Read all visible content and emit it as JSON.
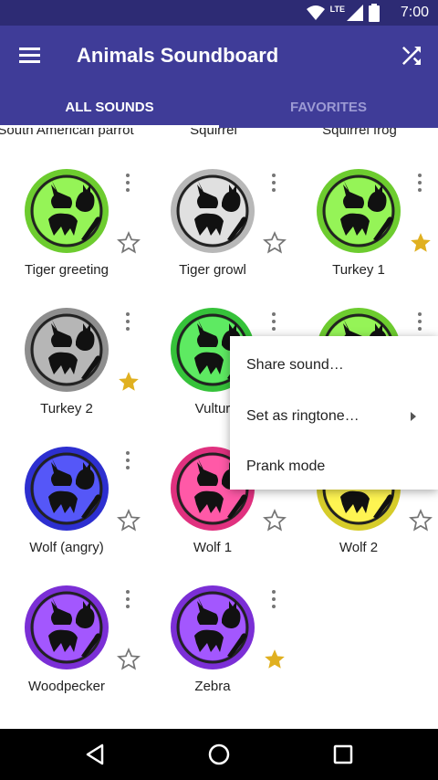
{
  "status_bar": {
    "time": "7:00",
    "network_label": "LTE"
  },
  "app_bar": {
    "title": "Animals Soundboard"
  },
  "tabs": [
    {
      "label": "ALL SOUNDS",
      "active": true
    },
    {
      "label": "FAVORITES",
      "active": false
    }
  ],
  "partial_row_labels": [
    "South American parrot",
    "Squirrel",
    "Squirrel frog"
  ],
  "sounds": [
    {
      "label": "Tiger greeting",
      "color": "#6dcc2f",
      "favorite": false
    },
    {
      "label": "Tiger growl",
      "color": "#b8b8b8",
      "favorite": false
    },
    {
      "label": "Turkey 1",
      "color": "#6dcc2f",
      "favorite": true
    },
    {
      "label": "Turkey 2",
      "color": "#8e8e8e",
      "favorite": true
    },
    {
      "label": "Vultur",
      "color": "#36c23a",
      "favorite": false
    },
    {
      "label": "",
      "color": "#6dcc2f",
      "favorite": false
    },
    {
      "label": "Wolf (angry)",
      "color": "#2d2fd0",
      "favorite": false
    },
    {
      "label": "Wolf 1",
      "color": "#e0317f",
      "favorite": false
    },
    {
      "label": "Wolf 2",
      "color": "#d6cc2a",
      "favorite": false
    },
    {
      "label": "Woodpecker",
      "color": "#7b2fd6",
      "favorite": false
    },
    {
      "label": "Zebra",
      "color": "#7b2fd6",
      "favorite": true
    }
  ],
  "context_menu": {
    "items": [
      "Share sound…",
      "Set as ringtone…",
      "Prank mode"
    ]
  },
  "colors": {
    "status_bar": "#2d2b74",
    "app_bar": "#3f3c98",
    "star_filled": "#e0b020",
    "star_outline": "#757575"
  }
}
